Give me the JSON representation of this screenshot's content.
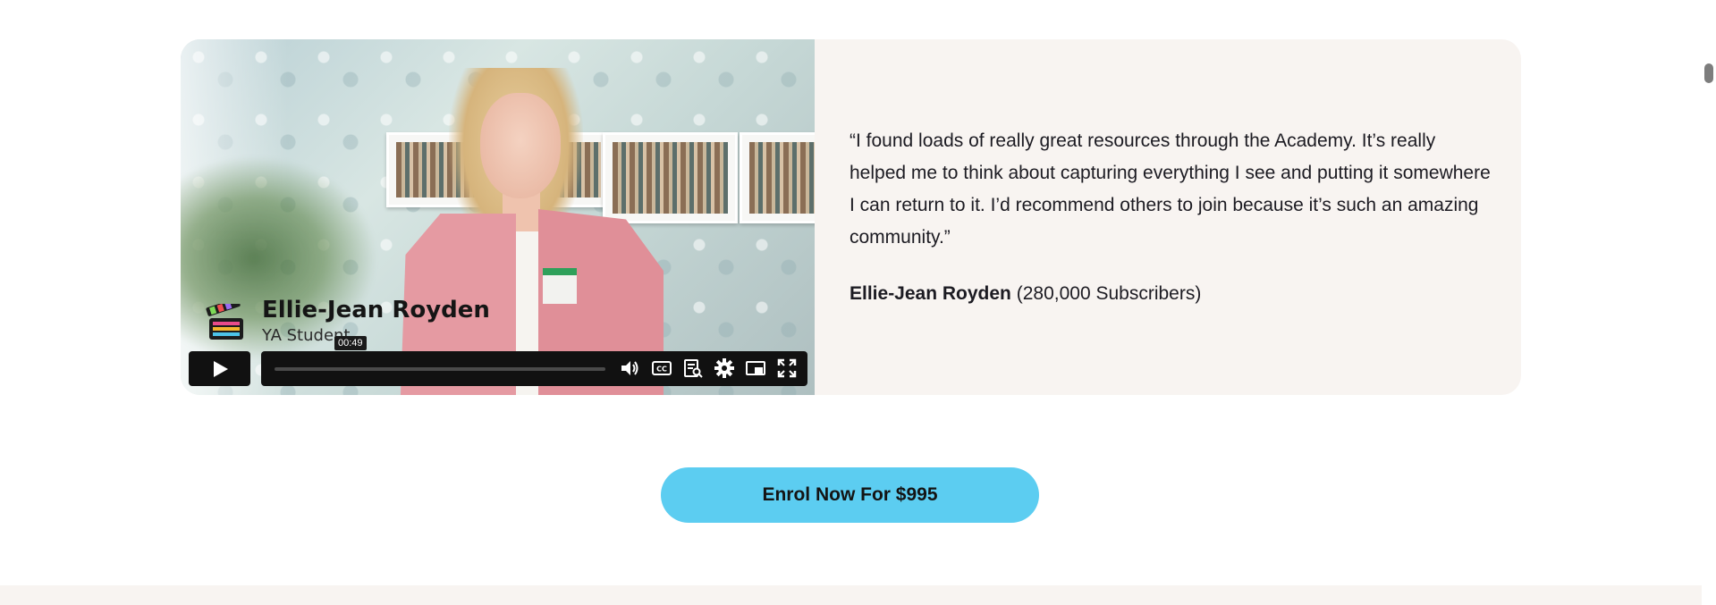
{
  "testimonial": {
    "quote": "“I found loads of really great resources through the Academy. It’s really helped me to think about capturing everything I see and putting it somewhere I can return to it. I’d recommend others to join because it’s such an amazing community.”",
    "author_name": "Ellie-Jean Royden",
    "author_detail": "(280,000 Subscribers)"
  },
  "video": {
    "lower_third_name": "Ellie-Jean Royden",
    "lower_third_role": "YA Student",
    "hover_time": "00:49",
    "progress_loaded_fraction": 0.0,
    "icons": {
      "play": "play-icon",
      "volume": "volume-icon",
      "captions": "captions-icon",
      "transcript": "transcript-icon",
      "settings": "gear-icon",
      "pip": "picture-in-picture-icon",
      "fullscreen": "fullscreen-icon"
    }
  },
  "cta": {
    "label": "Enrol Now For $995"
  },
  "colors": {
    "card_bg": "#f8f4f1",
    "cta_bg": "#5ccdf1",
    "text": "#1c1b22",
    "player_bar": "#111111"
  }
}
